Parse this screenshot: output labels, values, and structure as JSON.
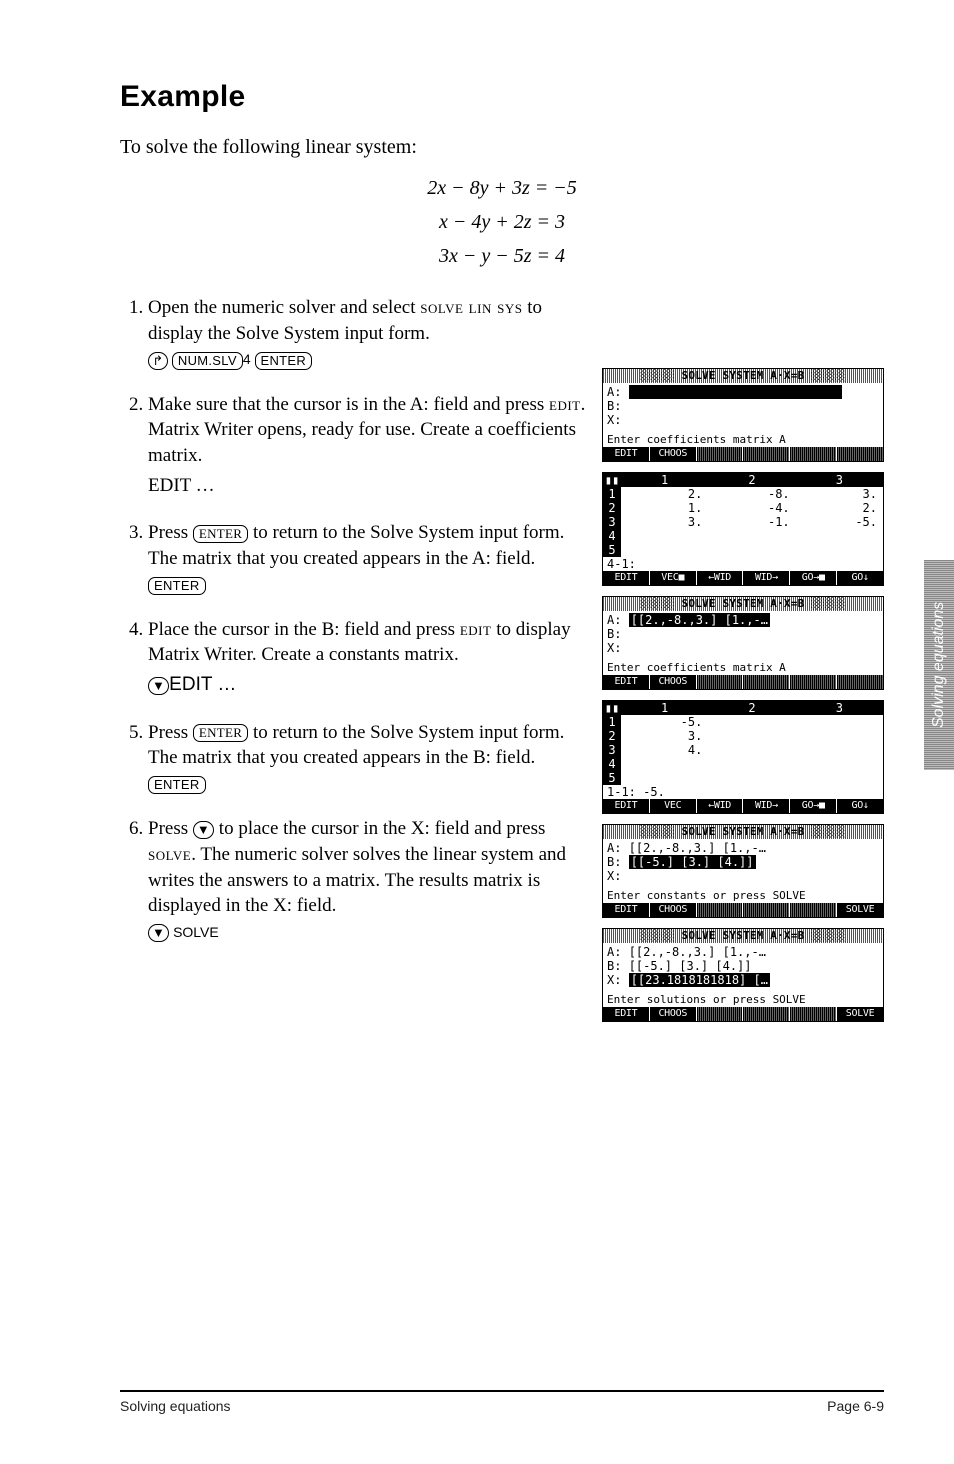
{
  "heading": "Example",
  "intro": "To solve the following linear system:",
  "equations": {
    "row1": "2x − 8y + 3z  =  −5",
    "row2": "x − 4y + 2z  =  3",
    "row3": "3x − y − 5z  =  4"
  },
  "steps": [
    {
      "text_before": "Open the numeric solver and select ",
      "sc1": "solve lin sys",
      "text_after": " to display the Solve System input form.",
      "keys_html": "⟶ NUM.SLV 4 ENTER",
      "keys": [
        {
          "type": "round",
          "label": "↱"
        },
        {
          "type": "box",
          "label": "NUM.SLV"
        },
        {
          "type": "plain",
          "label": "4"
        },
        {
          "type": "box",
          "label": "ENTER"
        }
      ]
    },
    {
      "text_before": "Make sure that the cursor is in the A: field and press ",
      "sc1": "edit",
      "text_after": ". Matrix Writer opens, ready for use. Create a coefficients matrix.",
      "subline": "EDIT …"
    },
    {
      "text_before": "Press ",
      "keyinline": "ENTER",
      "text_mid": " to return to the Solve System input form. The matrix that you created appears in the A: field.",
      "keys": [
        {
          "type": "box",
          "label": "ENTER"
        }
      ]
    },
    {
      "text_before": "Place the cursor in the B: field and press ",
      "sc1": "edit",
      "text_after": " to display Matrix Writer. Create a constants matrix.",
      "keys": [
        {
          "type": "round",
          "label": "▼"
        }
      ],
      "sub_after": "EDIT …"
    },
    {
      "text_before": "Press ",
      "keyinline": "ENTER",
      "text_mid": " to return to the Solve System input form. The matrix that you created appears in the B: field.",
      "keys": [
        {
          "type": "box",
          "label": "ENTER"
        }
      ]
    },
    {
      "text_before": "Press ",
      "keyinline_round": "▼",
      "text_mid": " to place the cursor in the X: field and press ",
      "sc1": "solve",
      "text_after": ". The numeric solver solves the linear system and writes the answers to a matrix. The results matrix is displayed in the X: field.",
      "keys": [
        {
          "type": "round",
          "label": "▼"
        }
      ],
      "sub_after_sc": "SOLVE"
    }
  ],
  "screens": {
    "s1": {
      "title": "SOLVE SYSTEM A·X=B",
      "A": "",
      "B": "",
      "X": "",
      "help": "Enter coefficients matrix A",
      "menu": [
        "EDIT",
        "CHOOS",
        "",
        "",
        "",
        ""
      ]
    },
    "s2": {
      "headers": [
        "1",
        "2",
        "3"
      ],
      "rows": [
        [
          "1",
          "2.",
          "-8.",
          "3."
        ],
        [
          "2",
          "1.",
          "-4.",
          "2."
        ],
        [
          "3",
          "3.",
          "-1.",
          "-5."
        ],
        [
          "4",
          "",
          "",
          ""
        ],
        [
          "5",
          "",
          "",
          ""
        ]
      ],
      "status": "4-1:",
      "menu": [
        "EDIT",
        "VEC■",
        "←WID",
        "WID→",
        "GO→■",
        "GO↓"
      ]
    },
    "s3": {
      "title": "SOLVE SYSTEM A·X=B",
      "A_hl": "[[2.,-8.,3.] [1.,-…",
      "B": "",
      "X": "",
      "help": "Enter coefficients matrix A",
      "menu": [
        "EDIT",
        "CHOOS",
        "",
        "",
        "",
        ""
      ]
    },
    "s4": {
      "headers": [
        "1",
        "2",
        "3"
      ],
      "rows": [
        [
          "1",
          "-5.",
          "",
          ""
        ],
        [
          "2",
          "3.",
          "",
          ""
        ],
        [
          "3",
          "4.",
          "",
          ""
        ],
        [
          "4",
          "",
          "",
          ""
        ],
        [
          "5",
          "",
          "",
          ""
        ]
      ],
      "status": "1-1: -5.",
      "menu": [
        "EDIT",
        "VEC",
        "←WID",
        "WID→",
        "GO→■",
        "GO↓"
      ]
    },
    "s5": {
      "title": "SOLVE SYSTEM A·X=B",
      "A": "[[2.,-8.,3.] [1.,-…",
      "B_hl": "[[-5.] [3.] [4.]]",
      "X": "",
      "help": "Enter constants or press SOLVE",
      "menu": [
        "EDIT",
        "CHOOS",
        "",
        "",
        "",
        "SOLVE"
      ]
    },
    "s6": {
      "title": "SOLVE SYSTEM A·X=B",
      "A": "[[2.,-8.,3.] [1.,-…",
      "B": "[[-5.] [3.] [4.]]",
      "X_hl": "[[23.1818181818] […",
      "help": "Enter solutions or press SOLVE",
      "menu": [
        "EDIT",
        "CHOOS",
        "",
        "",
        "",
        "SOLVE"
      ]
    }
  },
  "sidetab": "Solving equations",
  "footer": {
    "left": "Solving equations",
    "right": "Page 6-9"
  }
}
